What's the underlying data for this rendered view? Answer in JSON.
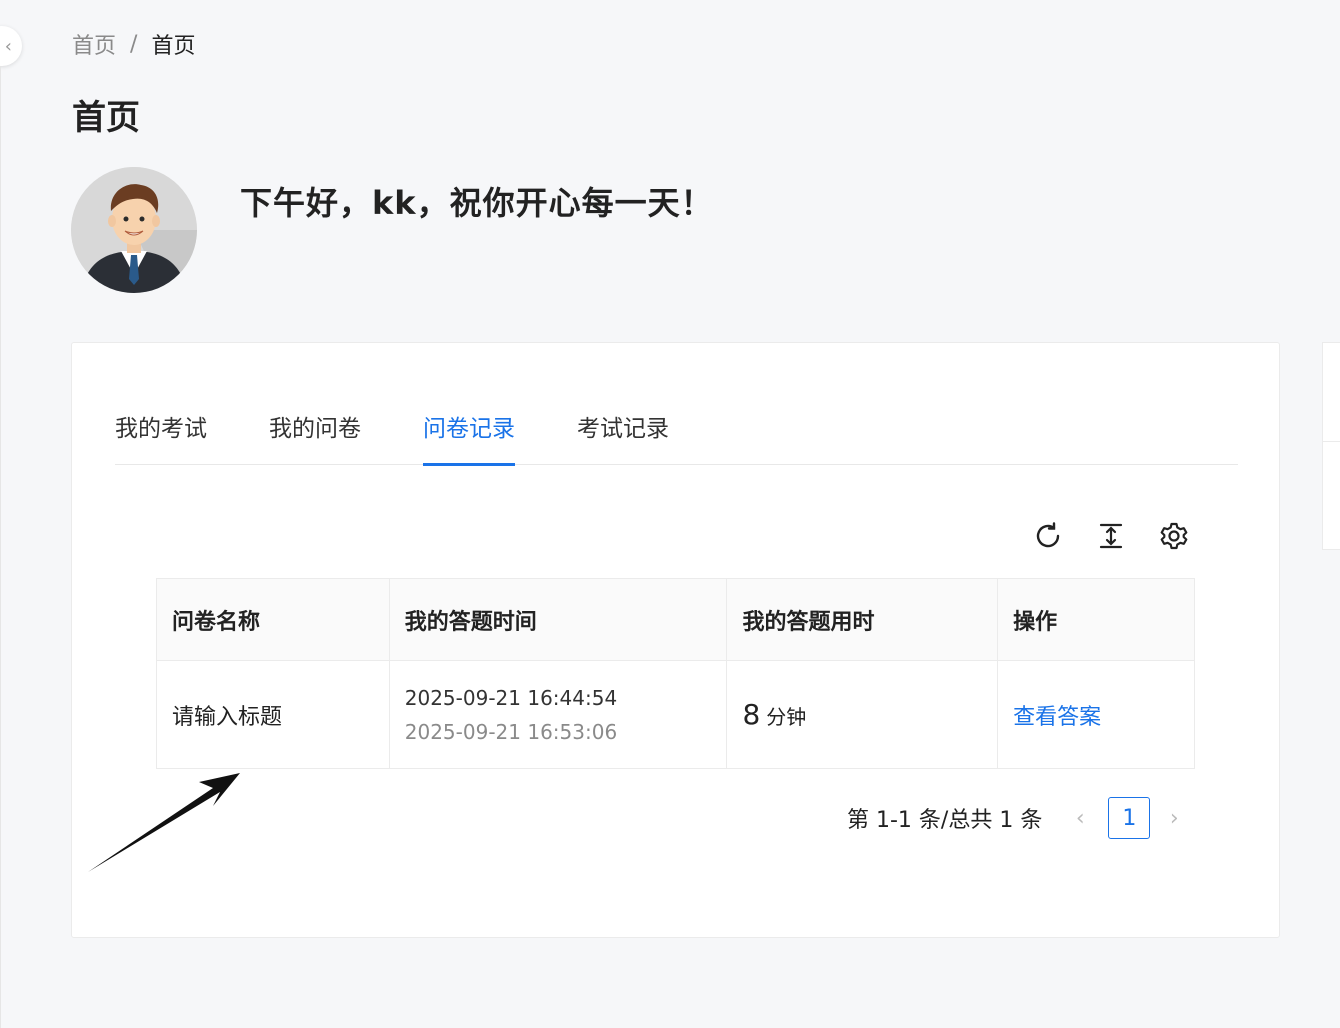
{
  "breadcrumb": {
    "home": "首页",
    "separator": "/",
    "current": "首页"
  },
  "page": {
    "title": "首页",
    "greeting": "下午好，kk，祝你开心每一天！"
  },
  "tabs": [
    {
      "label": "我的考试",
      "active": false
    },
    {
      "label": "我的问卷",
      "active": false
    },
    {
      "label": "问卷记录",
      "active": true
    },
    {
      "label": "考试记录",
      "active": false
    }
  ],
  "toolbar": {
    "icons": [
      "reload-icon",
      "column-height-icon",
      "settings-icon"
    ]
  },
  "table": {
    "columns": [
      "问卷名称",
      "我的答题时间",
      "我的答题用时",
      "操作"
    ],
    "rows": [
      {
        "name": "请输入标题",
        "start_time": "2025-09-21 16:44:54",
        "end_time": "2025-09-21 16:53:06",
        "duration_value": "8",
        "duration_unit": "分钟",
        "action": "查看答案"
      }
    ]
  },
  "pagination": {
    "total_text": "第 1-1 条/总共 1 条",
    "current_page": "1",
    "prev": "‹",
    "next": "›"
  },
  "colors": {
    "accent": "#1a73e8",
    "background": "#f6f7f9"
  }
}
